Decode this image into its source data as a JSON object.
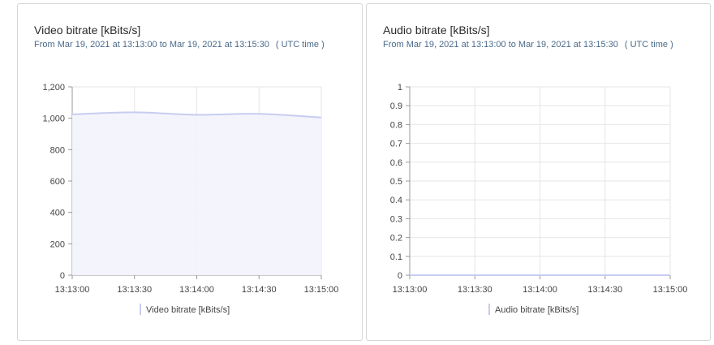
{
  "panels": [
    {
      "title": "Video bitrate [kBits/s]",
      "subtitle": "From Mar 19, 2021 at 13:13:00 to Mar 19, 2021 at 13:15:30",
      "timezone": "( UTC time )"
    },
    {
      "title": "Audio bitrate [kBits/s]",
      "subtitle": "From Mar 19, 2021 at 13:13:00 to Mar 19, 2021 at 13:15:30",
      "timezone": "( UTC time )"
    }
  ],
  "chart_data": [
    {
      "type": "area",
      "x": [
        "13:13:00",
        "13:13:30",
        "13:14:00",
        "13:14:30",
        "13:15:00"
      ],
      "series": [
        {
          "name": "Video bitrate [kBits/s]",
          "values": [
            1025,
            1038,
            1022,
            1028,
            1005
          ]
        }
      ],
      "ylim": [
        0,
        1200
      ],
      "yticks": [
        "0",
        "200",
        "400",
        "600",
        "800",
        "1,000",
        "1,200"
      ],
      "xticks": [
        "13:13:00",
        "13:13:30",
        "13:14:00",
        "13:14:30",
        "13:15:00"
      ],
      "grid": true,
      "legend": "bottom",
      "colors": {
        "line": "#c7cdf0",
        "fill": "#f3f4fc",
        "grid": "#e6e6e6",
        "axis": "#999999"
      }
    },
    {
      "type": "line",
      "x": [
        "13:13:00",
        "13:13:30",
        "13:14:00",
        "13:14:30",
        "13:15:00"
      ],
      "series": [
        {
          "name": "Audio bitrate [kBits/s]",
          "values": [
            0,
            0,
            0,
            0,
            0
          ]
        }
      ],
      "ylim": [
        0,
        1
      ],
      "yticks": [
        "0",
        "0.1",
        "0.2",
        "0.3",
        "0.4",
        "0.5",
        "0.6",
        "0.7",
        "0.8",
        "0.9",
        "1"
      ],
      "xticks": [
        "13:13:00",
        "13:13:30",
        "13:14:00",
        "13:14:30",
        "13:15:00"
      ],
      "grid": true,
      "legend": "bottom",
      "colors": {
        "line": "#c7cdf0",
        "fill": "#f3f4fc",
        "grid": "#e6e6e6",
        "axis": "#999999"
      }
    }
  ]
}
